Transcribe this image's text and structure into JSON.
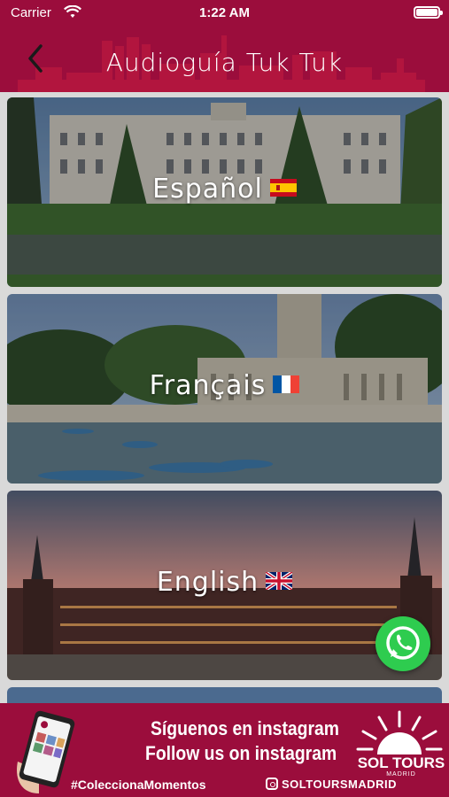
{
  "status_bar": {
    "carrier": "Carrier",
    "time": "1:22 AM"
  },
  "navbar": {
    "title": "Audioguía Tuk Tuk",
    "back_icon": "chevron-left-icon"
  },
  "languages": [
    {
      "label": "Español",
      "flag": "spain-flag-icon"
    },
    {
      "label": "Français",
      "flag": "france-flag-icon"
    },
    {
      "label": "English",
      "flag": "uk-flag-icon"
    }
  ],
  "fab": {
    "icon": "whatsapp-icon"
  },
  "banner": {
    "line1": "Síguenos en instagram",
    "line2": "Follow us on instagram",
    "hashtag": "#ColeccionaMomentos",
    "handle": "SOLTOURSMADRID",
    "brand": "SOL TOURS",
    "city": "MADRID"
  },
  "colors": {
    "brand": "#9b0d3c",
    "whatsapp": "#2ecc4f"
  }
}
